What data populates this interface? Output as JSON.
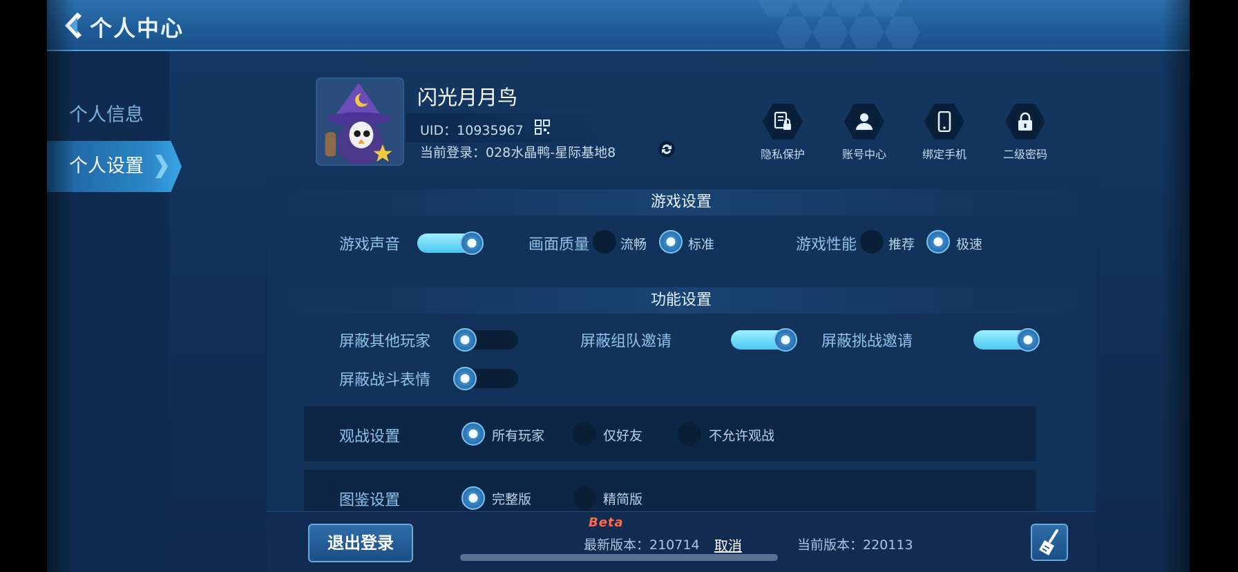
{
  "header": {
    "title": "个人中心"
  },
  "nav": [
    {
      "label": "个人信息",
      "active": false
    },
    {
      "label": "个人设置",
      "active": true
    }
  ],
  "profile": {
    "nickname": "闪光月月鸟",
    "uid": "UID：10935967",
    "login": "当前登录：028水晶鸭-星际基地8"
  },
  "quick_actions": [
    {
      "label": "隐私保护",
      "icon": "privacy-doc-lock-icon"
    },
    {
      "label": "账号中心",
      "icon": "user-icon"
    },
    {
      "label": "绑定手机",
      "icon": "phone-icon"
    },
    {
      "label": "二级密码",
      "icon": "lock-icon"
    }
  ],
  "game_settings": {
    "title": "游戏设置",
    "sound": {
      "label": "游戏声音",
      "on": true
    },
    "quality": {
      "label": "画面质量",
      "options": [
        "流畅",
        "标准"
      ],
      "selected": "标准"
    },
    "performance": {
      "label": "游戏性能",
      "options": [
        "推荐",
        "极速"
      ],
      "selected": "极速"
    }
  },
  "function_settings": {
    "title": "功能设置",
    "toggles": [
      {
        "label": "屏蔽其他玩家",
        "on": false
      },
      {
        "label": "屏蔽组队邀请",
        "on": true
      },
      {
        "label": "屏蔽挑战邀请",
        "on": true
      },
      {
        "label": "屏蔽战斗表情",
        "on": false
      }
    ]
  },
  "spectate": {
    "label": "观战设置",
    "options": [
      "所有玩家",
      "仅好友",
      "不允许观战"
    ],
    "selected": "所有玩家"
  },
  "atlas": {
    "label": "图鉴设置",
    "options": [
      "完整版",
      "精简版"
    ],
    "selected": "完整版"
  },
  "footer": {
    "logout": "退出登录",
    "beta": "Beta",
    "latest_version": "最新版本：210714",
    "cancel": "取消",
    "current_version": "当前版本：220113"
  },
  "colors": {
    "accent": "#4cc6f2",
    "panel": "#12325a",
    "beta": "#ff6a4a"
  }
}
